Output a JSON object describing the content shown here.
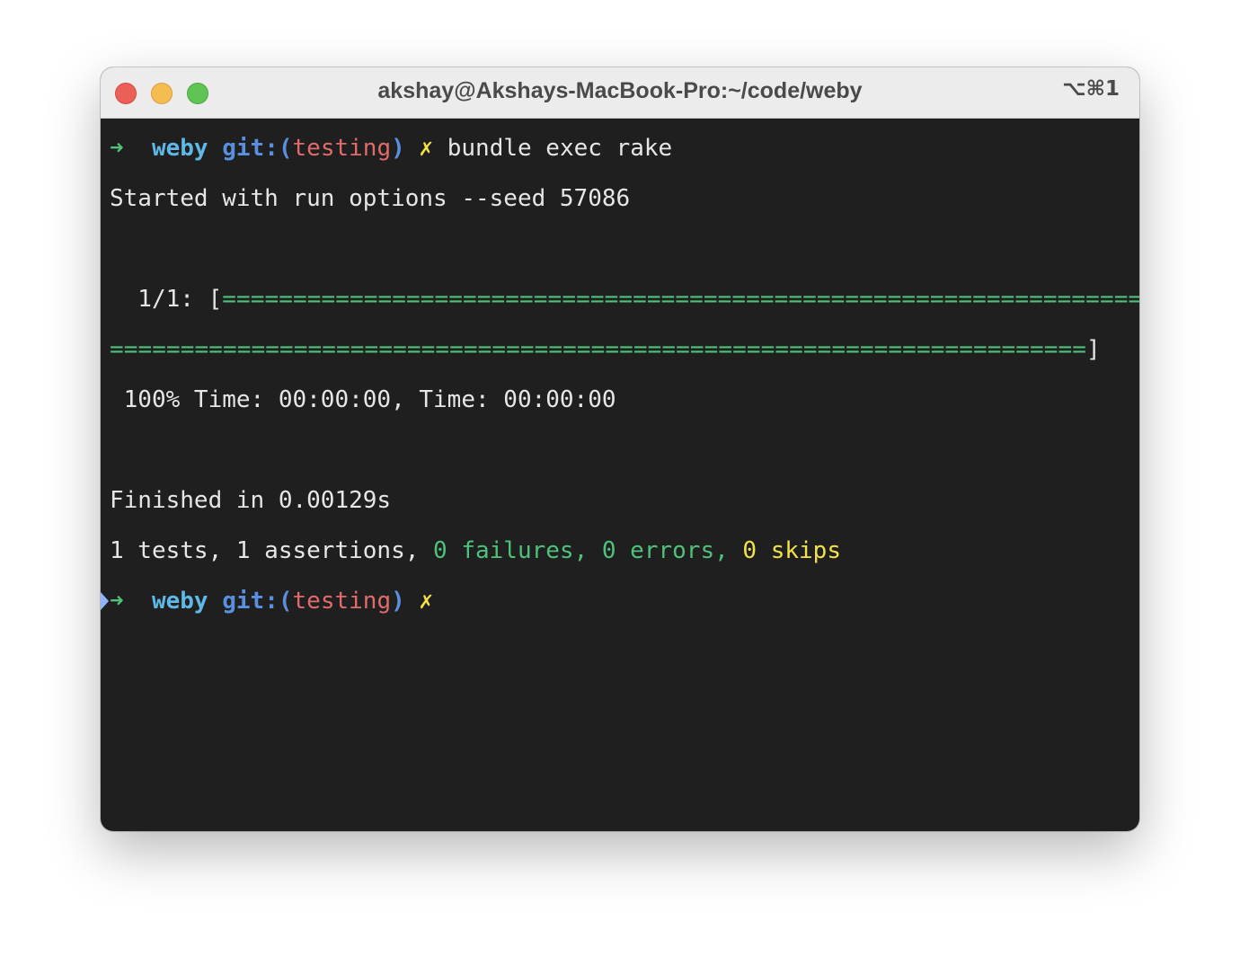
{
  "window": {
    "title": "akshay@Akshays-MacBook-Pro:~/code/weby",
    "shortcut": "⌥⌘1"
  },
  "colors": {
    "background": "#1f1f1f",
    "prompt_arrow": "#4ec27a",
    "dir": "#5fb8e6",
    "git": "#5a8fe0",
    "branch": "#e26a6a",
    "dirty": "#f2e24a",
    "pass": "#4ec27a",
    "skip": "#f2e24a"
  },
  "prompt": {
    "arrow": "➜",
    "dir": "weby",
    "git_open": "git:(",
    "branch": "testing",
    "git_close": ")",
    "dirty_mark": "✗"
  },
  "lines": {
    "command": "bundle exec rake",
    "seed": "Started with run options --seed 57086",
    "progress_label": "  1/1: ",
    "progress_open": "[",
    "progress_bar_1": "=================================================================",
    "progress_bar_2": "=====================================================================",
    "progress_close": "]",
    "time": " 100% Time: 00:00:00, Time: 00:00:00",
    "finished": "Finished in 0.00129s",
    "summary_prefix": "1 tests, 1 assertions, ",
    "summary_failures": "0 failures, 0 errors, ",
    "summary_skips": "0 skips"
  },
  "progress": {
    "completed": 1,
    "total": 1,
    "percent": 100
  }
}
